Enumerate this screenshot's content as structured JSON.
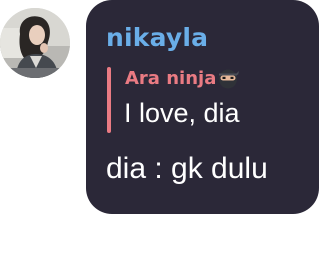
{
  "message": {
    "avatar_icon": "user-avatar-photo",
    "sender_name": "nikayla",
    "sender_color": "#6aaee8",
    "bubble_color": "#2b2838",
    "reply": {
      "author": "Ara ninja",
      "author_icon": "ninja-emoji-icon",
      "author_color": "#ea7b83",
      "text": "I love, dia"
    },
    "text": "dia : gk dulu"
  }
}
